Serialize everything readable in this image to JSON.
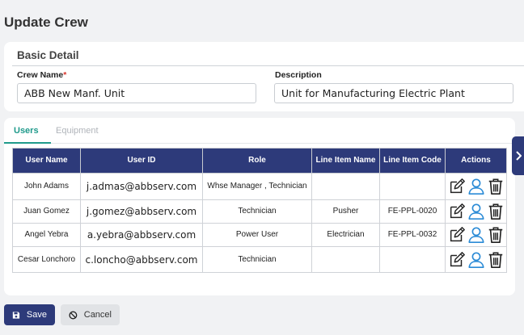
{
  "page": {
    "title": "Update Crew"
  },
  "basic_detail": {
    "title": "Basic Detail",
    "crew_name": {
      "label": "Crew Name",
      "required_mark": "*",
      "value": "ABB New Manf. Unit"
    },
    "description": {
      "label": "Description",
      "value": "Unit for Manufacturing Electric Plant"
    }
  },
  "tabs": [
    {
      "label": "Users",
      "active": true
    },
    {
      "label": "Equipment",
      "active": false
    }
  ],
  "table": {
    "headers": [
      "User Name",
      "User ID",
      "Role",
      "Line Item Name",
      "Line Item Code",
      "Actions"
    ],
    "rows": [
      {
        "user_name": "John Adams",
        "user_id": "j.admas@abbserv.com",
        "role": "Whse Manager , Technician",
        "line_item_name": "",
        "line_item_code": ""
      },
      {
        "user_name": "Juan Gomez",
        "user_id": "j.gomez@abbserv.com",
        "role": "Technician",
        "line_item_name": "Pusher",
        "line_item_code": "FE-PPL-0020"
      },
      {
        "user_name": "Angel Yebra",
        "user_id": "a.yebra@abbserv.com",
        "role": "Power User",
        "line_item_name": "Electrician",
        "line_item_code": "FE-PPL-0032"
      },
      {
        "user_name": "Cesar Lonchoro",
        "user_id": "c.loncho@abbserv.com",
        "role": "Technician",
        "line_item_name": "",
        "line_item_code": ""
      }
    ],
    "action_icons": [
      "edit-icon",
      "user-icon",
      "trash-icon"
    ]
  },
  "buttons": {
    "save": "Save",
    "cancel": "Cancel"
  },
  "colors": {
    "header_navy": "#2d3a7a",
    "accent_teal": "#1f9a8b",
    "icon_blue": "#2b8bd6"
  }
}
